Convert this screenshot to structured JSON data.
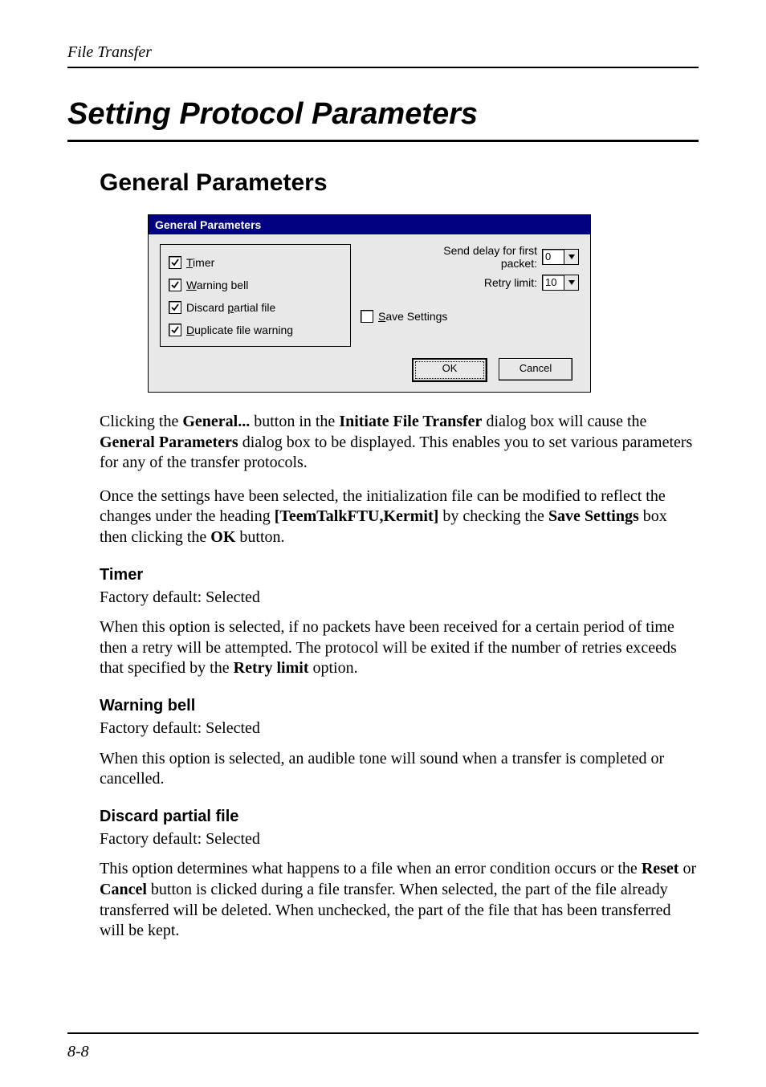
{
  "runningHead": "File Transfer",
  "sectionTitle": "Setting Protocol Parameters",
  "subsectionTitle": "General Parameters",
  "dialog": {
    "title": "General Parameters",
    "checkboxes": {
      "timer": {
        "checked": true,
        "pre": "",
        "u": "T",
        "post": "imer"
      },
      "warning": {
        "checked": true,
        "pre": "",
        "u": "W",
        "post": "arning bell"
      },
      "discard": {
        "checked": true,
        "pre": "Discard ",
        "u": "p",
        "post": "artial file"
      },
      "duplicate": {
        "checked": true,
        "pre": "",
        "u": "D",
        "post": "uplicate file warning"
      },
      "save": {
        "checked": false,
        "pre": "",
        "u": "S",
        "post": "ave Settings"
      }
    },
    "labels": {
      "sendDelayLine1": "Send delay for first",
      "sendDelayLine2": "packet:",
      "retryLimit": "Retry limit:"
    },
    "values": {
      "sendDelay": "0",
      "retryLimit": "10"
    },
    "buttons": {
      "ok": "OK",
      "cancel": "Cancel"
    }
  },
  "para1": {
    "t1": "Clicking the ",
    "b1": "General...",
    "t2": " button in the ",
    "b2": "Initiate File Transfer",
    "t3": " dialog box will cause the ",
    "b3": "General Parameters",
    "t4": " dialog box to be displayed. This enables you to set various parameters for any of the transfer protocols."
  },
  "para2": {
    "t1": "Once the settings have been selected, the initialization file can be modified to reflect the changes under the heading ",
    "b1": "[TeemTalkFTU,Kermit]",
    "t2": " by checking the ",
    "b2": "Save Settings",
    "t3": " box then clicking the ",
    "b3": "OK",
    "t4": " button."
  },
  "opts": {
    "timer": {
      "head": "Timer",
      "def": "Factory default: Selected",
      "p_t1": "When this option is selected, if no packets have been received for a certain period of time then a retry will be attempted. The protocol will be exited if the number of retries exceeds that specified by the ",
      "p_b1": "Retry limit",
      "p_t2": " option."
    },
    "warning": {
      "head": "Warning bell",
      "def": "Factory default: Selected",
      "p": "When this option is selected, an audible tone will sound when a transfer is completed or cancelled."
    },
    "discard": {
      "head": "Discard partial file",
      "def": "Factory default: Selected",
      "p_t1": "This option determines what happens to a file when an error condition occurs or the ",
      "p_b1": "Reset",
      "p_t2": " or ",
      "p_b2": "Cancel",
      "p_t3": " button is clicked during a file transfer. When selected, the part of the file already transferred will be deleted. When unchecked, the part of the file that has been transferred will be kept."
    }
  },
  "pageNumber": "8-8"
}
